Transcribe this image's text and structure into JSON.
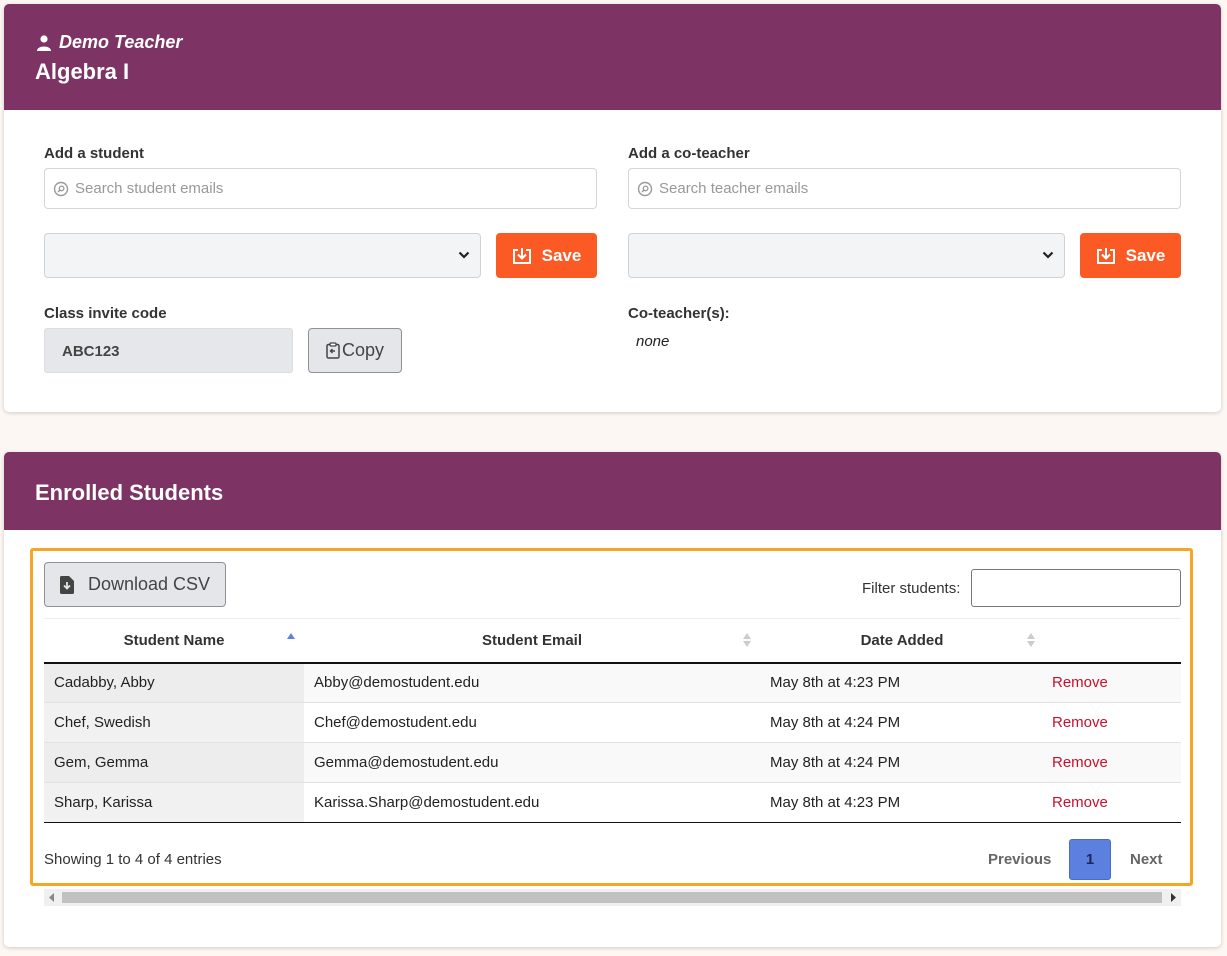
{
  "class_card": {
    "teacher_name": "Demo Teacher",
    "course_title": "Algebra I",
    "add_student": {
      "label": "Add a student",
      "search_placeholder": "Search student emails",
      "save_label": "Save"
    },
    "add_coteacher": {
      "label": "Add a co-teacher",
      "search_placeholder": "Search teacher emails",
      "save_label": "Save"
    },
    "invite": {
      "label": "Class invite code",
      "code": "ABC123",
      "copy_label": "Copy"
    },
    "coteachers": {
      "label": "Co-teacher(s):",
      "value": "none"
    }
  },
  "enrolled": {
    "title": "Enrolled Students",
    "download_label": "Download CSV",
    "filter_label": "Filter students:",
    "columns": [
      "Student Name",
      "Student Email",
      "Date Added",
      ""
    ],
    "rows": [
      {
        "name": "Cadabby, Abby",
        "email": "Abby@demostudent.edu",
        "date": "May 8th at 4:23 PM",
        "action": "Remove"
      },
      {
        "name": "Chef, Swedish",
        "email": "Chef@demostudent.edu",
        "date": "May 8th at 4:24 PM",
        "action": "Remove"
      },
      {
        "name": "Gem, Gemma",
        "email": "Gemma@demostudent.edu",
        "date": "May 8th at 4:24 PM",
        "action": "Remove"
      },
      {
        "name": "Sharp, Karissa",
        "email": "Karissa.Sharp@demostudent.edu",
        "date": "May 8th at 4:23 PM",
        "action": "Remove"
      }
    ],
    "showing_text": "Showing 1 to 4 of 4 entries",
    "pagination": {
      "previous": "Previous",
      "current": "1",
      "next": "Next"
    }
  },
  "colors": {
    "header": "#7d3465",
    "save_button": "#fb5a24",
    "remove_link": "#c8102e",
    "active_page": "#5b80e0",
    "highlight": "#f5a623"
  },
  "icons": [
    "user-icon",
    "search-icon",
    "chevron-down-icon",
    "save-download-icon",
    "clipboard-icon",
    "file-download-icon",
    "sort-asc-icon",
    "sort-both-icon"
  ]
}
